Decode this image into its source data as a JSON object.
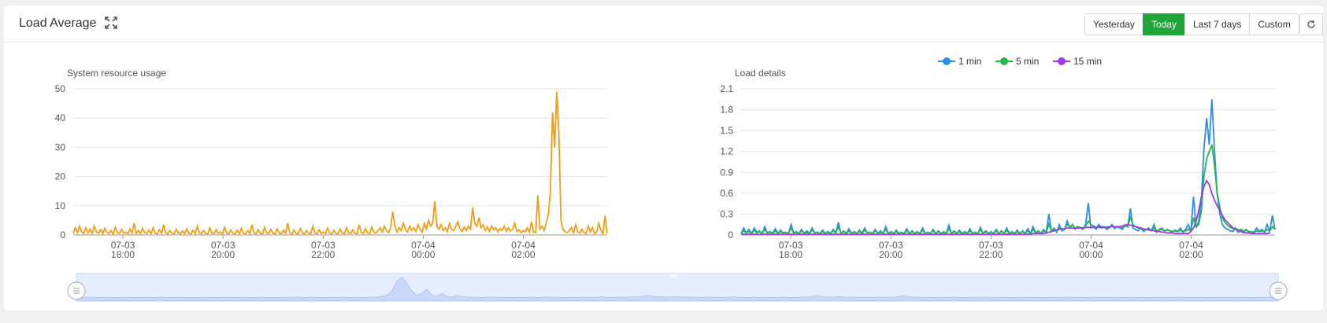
{
  "header": {
    "title": "Load Average",
    "expand_icon": "expand-icon",
    "ranges": [
      "Yesterday",
      "Today",
      "Last 7 days",
      "Custom"
    ],
    "active_range": "Today",
    "refresh_icon": "refresh-icon"
  },
  "colors": {
    "accent": "#20a53a",
    "resource": "#f39c12",
    "min1": "#2d8cf0",
    "min5": "#20b845",
    "min15": "#9f3af0"
  },
  "chart_data": [
    {
      "type": "area",
      "title": "System resource usage",
      "ylim": [
        0,
        50
      ],
      "yticks": [
        0,
        10,
        20,
        30,
        40,
        50
      ],
      "xticks": [
        [
          "07-03",
          "18:00"
        ],
        [
          "07-03",
          "20:00"
        ],
        [
          "07-03",
          "22:00"
        ],
        [
          "07-04",
          "00:00"
        ],
        [
          "07-04",
          "02:00"
        ]
      ],
      "series": [
        {
          "values": [
            0.5,
            2.5,
            0.8,
            3,
            1,
            0.5,
            2.5,
            0.7,
            2,
            0.5,
            3,
            1,
            0.6,
            1.8,
            0.4,
            2.2,
            0.9,
            0.5,
            1.5,
            0.3,
            2.6,
            0.8,
            0.5,
            1.9,
            0.6,
            1,
            0.4,
            2,
            0.7,
            4,
            0.5,
            1.5,
            0.4,
            2.2,
            0.8,
            0.5,
            1.6,
            0.4,
            2.5,
            0.6,
            0.4,
            1.8,
            0.5,
            3.5,
            0.8,
            0.4,
            1.5,
            0.6,
            0.4,
            2,
            0.7,
            0.4,
            1.4,
            0.4,
            2.1,
            0.6,
            0.4,
            1.6,
            0.5,
            3,
            0.7,
            0.4,
            1.5,
            0.5,
            0.4,
            2.4,
            0.6,
            0.4,
            1.8,
            0.5,
            1,
            0.4,
            2.6,
            0.6,
            0.4,
            1.7,
            0.5,
            0.4,
            1.6,
            0.4,
            2.3,
            0.6,
            0.4,
            1.5,
            0.5,
            3.5,
            0.7,
            0.4,
            1.8,
            0.5,
            0.4,
            2.6,
            0.7,
            0.5,
            1.9,
            0.6,
            0.4,
            2.1,
            0.6,
            0.4,
            1.6,
            0.5,
            4,
            0.7,
            0.4,
            1.7,
            0.5,
            0.4,
            2.2,
            0.6,
            0.4,
            1.5,
            0.5,
            0.4,
            3,
            0.6,
            0.4,
            1.8,
            0.5,
            1,
            0.4,
            2.4,
            0.6,
            0.4,
            1.6,
            0.5,
            0.4,
            2,
            0.6,
            0.4,
            2.6,
            0.7,
            0.5,
            1.8,
            0.6,
            0.4,
            3.5,
            0.8,
            0.5,
            2.2,
            0.7,
            0.5,
            2.8,
            0.9,
            0.6,
            1.5,
            2.5,
            1,
            3,
            1.5,
            0.8,
            2.5,
            8,
            3,
            1,
            2.5,
            1.5,
            4,
            2,
            1,
            3,
            1.5,
            2.5,
            1.2,
            3.5,
            2,
            1,
            4,
            2,
            5,
            3,
            4,
            11.5,
            3,
            2,
            3.5,
            1.5,
            2.5,
            1.2,
            4,
            2,
            1.5,
            3,
            4.5,
            2,
            1.2,
            2.8,
            1.5,
            3,
            2,
            9.5,
            4,
            3,
            6,
            2.5,
            3.5,
            1.5,
            2.8,
            1.2,
            3,
            1.8,
            2.5,
            1,
            2.2,
            1.5,
            3,
            1.2,
            2.5,
            1.4,
            2,
            4,
            1.2,
            1.8,
            0.8,
            1.5,
            1,
            2.5,
            1,
            4.5,
            1,
            0.8,
            13.5,
            2,
            3,
            1.5,
            4,
            7,
            15,
            42,
            30,
            49,
            35,
            5,
            2,
            1,
            0.8,
            1.5,
            2.5,
            0.8,
            3.5,
            1,
            0.6,
            2,
            0.8,
            0.5,
            3,
            1,
            2.5,
            0.5,
            1,
            4,
            1.5,
            0.5,
            6.5,
            0.5
          ]
        }
      ],
      "slider_preview": [
        1,
        1.2,
        1,
        1.1,
        1,
        1,
        1.1,
        1,
        1,
        1,
        1.1,
        1,
        1,
        1,
        1.1,
        1,
        1,
        1.2,
        1,
        1,
        1.1,
        1,
        1,
        1,
        1,
        1,
        1.1,
        1,
        1,
        1,
        1.1,
        1,
        1,
        1.1,
        1,
        1,
        1,
        1.1,
        1,
        1,
        1,
        1.1,
        1,
        1,
        1.2,
        1,
        1,
        1.1,
        1,
        1,
        1,
        1.1,
        1,
        1.2,
        1,
        1,
        1.1,
        1,
        1,
        1.2,
        1,
        1.5,
        2,
        4,
        9,
        11,
        8,
        4,
        2,
        3,
        5,
        2,
        1.5,
        3,
        1.5,
        1,
        2,
        1.5,
        1,
        1.2,
        1,
        1,
        1,
        1.2,
        1,
        1.1,
        1,
        1,
        1,
        1.1,
        1,
        1.2,
        1,
        1,
        1.3,
        1,
        1.1,
        1,
        1,
        1.1,
        1,
        1.2,
        1,
        1.1,
        1,
        1.3,
        1,
        1.1,
        1,
        1.2,
        1,
        1.3,
        1.2,
        1.5,
        2,
        1.6,
        1.4,
        1.3,
        1.1,
        1.5,
        1.3,
        1.2,
        1.1,
        1.2,
        1.1,
        1,
        1.2,
        1.1,
        1,
        1.1,
        1,
        1.3,
        1.1,
        1,
        1,
        1.1,
        1,
        1,
        1.1,
        1,
        1,
        1.2,
        1,
        1,
        1,
        1.2,
        1.1,
        1.4,
        2,
        1.3,
        1.2,
        1.1,
        1.4,
        1.2,
        1,
        1.2,
        1.1,
        1,
        1.1,
        1,
        1.2,
        1.1,
        1,
        1.1,
        1.3,
        1.8,
        1.4,
        1.2,
        1.1,
        1,
        1.1,
        1,
        1,
        1.1,
        1,
        1.2,
        1,
        1,
        1,
        1.1,
        1,
        1.2,
        1.1,
        1,
        1,
        1.1,
        1,
        1,
        1,
        1.1,
        1,
        1.1,
        1,
        1,
        1,
        1.1,
        1,
        1,
        1.2,
        1,
        1.1,
        1,
        1,
        1.1,
        1,
        1.1,
        1,
        1.1,
        1,
        1,
        1.1,
        1,
        1,
        1.1,
        1,
        1,
        1.1,
        1,
        1,
        1.1,
        1,
        1.2,
        1,
        1,
        1.1,
        1,
        1,
        1,
        1.1,
        1,
        1.1,
        1,
        1,
        1.1,
        1,
        1,
        1.1,
        1,
        1,
        1.1,
        1
      ]
    },
    {
      "type": "line",
      "title": "Load details",
      "ylim": [
        0,
        2.1
      ],
      "yticks": [
        0,
        0.3,
        0.6,
        0.9,
        1.2,
        1.5,
        1.8,
        2.1
      ],
      "xticks": [
        [
          "07-03",
          "18:00"
        ],
        [
          "07-03",
          "20:00"
        ],
        [
          "07-03",
          "22:00"
        ],
        [
          "07-04",
          "00:00"
        ],
        [
          "07-04",
          "02:00"
        ]
      ],
      "legend": [
        "1 min",
        "5 min",
        "15 min"
      ],
      "series": [
        {
          "name": "1 min",
          "values": [
            0.02,
            0.1,
            0.03,
            0.08,
            0.02,
            0.1,
            0.04,
            0.06,
            0.02,
            0.12,
            0.03,
            0.05,
            0.02,
            0.09,
            0.02,
            0.07,
            0.03,
            0.04,
            0.02,
            0.15,
            0.03,
            0.05,
            0.02,
            0.08,
            0.02,
            0.06,
            0.02,
            0.1,
            0.03,
            0.04,
            0.02,
            0.07,
            0.02,
            0.05,
            0.02,
            0.08,
            0.03,
            0.18,
            0.02,
            0.06,
            0.02,
            0.09,
            0.02,
            0.05,
            0.02,
            0.07,
            0.02,
            0.1,
            0.03,
            0.04,
            0.02,
            0.08,
            0.02,
            0.06,
            0.02,
            0.12,
            0.02,
            0.05,
            0.02,
            0.07,
            0.02,
            0.04,
            0.02,
            0.09,
            0.02,
            0.06,
            0.02,
            0.05,
            0.02,
            0.1,
            0.02,
            0.04,
            0.02,
            0.08,
            0.02,
            0.06,
            0.02,
            0.05,
            0.02,
            0.14,
            0.02,
            0.06,
            0.02,
            0.07,
            0.02,
            0.05,
            0.02,
            0.09,
            0.02,
            0.04,
            0.02,
            0.11,
            0.02,
            0.06,
            0.02,
            0.05,
            0.02,
            0.08,
            0.02,
            0.06,
            0.02,
            0.1,
            0.02,
            0.05,
            0.02,
            0.07,
            0.02,
            0.06,
            0.02,
            0.09,
            0.02,
            0.12,
            0.03,
            0.06,
            0.02,
            0.08,
            0.03,
            0.3,
            0.05,
            0.1,
            0.04,
            0.15,
            0.06,
            0.08,
            0.2,
            0.1,
            0.15,
            0.08,
            0.12,
            0.1,
            0.08,
            0.15,
            0.46,
            0.1,
            0.12,
            0.08,
            0.15,
            0.1,
            0.12,
            0.08,
            0.1,
            0.15,
            0.09,
            0.12,
            0.1,
            0.08,
            0.15,
            0.12,
            0.38,
            0.1,
            0.08,
            0.06,
            0.1,
            0.05,
            0.08,
            0.1,
            0.06,
            0.15,
            0.04,
            0.08,
            0.1,
            0.05,
            0.08,
            0.06,
            0.04,
            0.07,
            0.05,
            0.1,
            0.04,
            0.08,
            0.15,
            0.05,
            0.55,
            0.1,
            0.2,
            0.5,
            1.25,
            1.68,
            1.3,
            1.95,
            1.2,
            0.6,
            0.3,
            0.15,
            0.1,
            0.08,
            0.06,
            0.05,
            0.1,
            0.04,
            0.06,
            0.03,
            0.08,
            0.04,
            0.05,
            0.03,
            0.1,
            0.05,
            0.08,
            0.04,
            0.15,
            0.05,
            0.28,
            0.08
          ]
        },
        {
          "name": "5 min",
          "values": [
            0.02,
            0.06,
            0.03,
            0.05,
            0.02,
            0.07,
            0.03,
            0.05,
            0.02,
            0.08,
            0.03,
            0.04,
            0.02,
            0.06,
            0.02,
            0.05,
            0.03,
            0.04,
            0.02,
            0.1,
            0.03,
            0.04,
            0.02,
            0.06,
            0.02,
            0.04,
            0.02,
            0.07,
            0.03,
            0.04,
            0.02,
            0.05,
            0.02,
            0.04,
            0.02,
            0.06,
            0.03,
            0.12,
            0.02,
            0.05,
            0.02,
            0.06,
            0.02,
            0.04,
            0.02,
            0.05,
            0.02,
            0.07,
            0.03,
            0.04,
            0.02,
            0.06,
            0.02,
            0.04,
            0.02,
            0.08,
            0.02,
            0.04,
            0.02,
            0.05,
            0.02,
            0.04,
            0.02,
            0.06,
            0.02,
            0.05,
            0.02,
            0.04,
            0.02,
            0.07,
            0.02,
            0.04,
            0.02,
            0.06,
            0.02,
            0.05,
            0.02,
            0.04,
            0.02,
            0.09,
            0.02,
            0.05,
            0.02,
            0.05,
            0.02,
            0.04,
            0.02,
            0.06,
            0.02,
            0.04,
            0.02,
            0.08,
            0.02,
            0.05,
            0.02,
            0.04,
            0.02,
            0.06,
            0.02,
            0.05,
            0.02,
            0.07,
            0.02,
            0.04,
            0.02,
            0.05,
            0.02,
            0.05,
            0.02,
            0.06,
            0.02,
            0.08,
            0.03,
            0.05,
            0.02,
            0.06,
            0.03,
            0.16,
            0.05,
            0.08,
            0.05,
            0.1,
            0.08,
            0.09,
            0.15,
            0.12,
            0.14,
            0.1,
            0.12,
            0.11,
            0.1,
            0.13,
            0.2,
            0.15,
            0.13,
            0.11,
            0.13,
            0.12,
            0.12,
            0.1,
            0.11,
            0.13,
            0.11,
            0.12,
            0.11,
            0.1,
            0.13,
            0.12,
            0.25,
            0.15,
            0.12,
            0.1,
            0.1,
            0.08,
            0.08,
            0.09,
            0.07,
            0.1,
            0.06,
            0.07,
            0.08,
            0.06,
            0.07,
            0.06,
            0.05,
            0.06,
            0.05,
            0.07,
            0.05,
            0.06,
            0.08,
            0.06,
            0.25,
            0.12,
            0.15,
            0.35,
            0.85,
            1.1,
            1.2,
            1.3,
            1.0,
            0.6,
            0.4,
            0.25,
            0.18,
            0.14,
            0.11,
            0.09,
            0.1,
            0.07,
            0.08,
            0.06,
            0.07,
            0.05,
            0.05,
            0.04,
            0.06,
            0.05,
            0.06,
            0.05,
            0.08,
            0.06,
            0.12,
            0.08
          ]
        },
        {
          "name": "15 min",
          "values": [
            0.01,
            0.01,
            0.01,
            0.01,
            0.01,
            0.01,
            0.01,
            0.01,
            0.01,
            0.01,
            0.01,
            0.01,
            0.01,
            0.01,
            0.01,
            0.01,
            0.01,
            0.01,
            0.01,
            0.01,
            0.01,
            0.01,
            0.01,
            0.01,
            0.01,
            0.01,
            0.01,
            0.01,
            0.01,
            0.01,
            0.01,
            0.01,
            0.01,
            0.01,
            0.01,
            0.01,
            0.01,
            0.01,
            0.01,
            0.01,
            0.01,
            0.01,
            0.01,
            0.01,
            0.01,
            0.01,
            0.01,
            0.01,
            0.01,
            0.01,
            0.01,
            0.01,
            0.01,
            0.01,
            0.01,
            0.01,
            0.01,
            0.01,
            0.01,
            0.01,
            0.01,
            0.01,
            0.01,
            0.01,
            0.01,
            0.01,
            0.01,
            0.01,
            0.01,
            0.01,
            0.01,
            0.01,
            0.01,
            0.01,
            0.01,
            0.01,
            0.01,
            0.01,
            0.01,
            0.01,
            0.01,
            0.01,
            0.01,
            0.01,
            0.01,
            0.01,
            0.01,
            0.01,
            0.01,
            0.01,
            0.01,
            0.01,
            0.01,
            0.01,
            0.01,
            0.01,
            0.01,
            0.01,
            0.01,
            0.01,
            0.01,
            0.01,
            0.01,
            0.01,
            0.01,
            0.01,
            0.01,
            0.01,
            0.01,
            0.01,
            0.01,
            0.02,
            0.02,
            0.02,
            0.02,
            0.02,
            0.03,
            0.04,
            0.05,
            0.06,
            0.07,
            0.08,
            0.09,
            0.09,
            0.1,
            0.1,
            0.1,
            0.1,
            0.1,
            0.1,
            0.1,
            0.11,
            0.11,
            0.11,
            0.11,
            0.11,
            0.11,
            0.11,
            0.11,
            0.11,
            0.12,
            0.12,
            0.12,
            0.12,
            0.12,
            0.13,
            0.14,
            0.15,
            0.14,
            0.13,
            0.12,
            0.11,
            0.1,
            0.09,
            0.08,
            0.07,
            0.07,
            0.06,
            0.05,
            0.05,
            0.04,
            0.04,
            0.03,
            0.03,
            0.03,
            0.02,
            0.02,
            0.02,
            0.02,
            0.02,
            0.02,
            0.05,
            0.1,
            0.2,
            0.35,
            0.55,
            0.7,
            0.78,
            0.72,
            0.6,
            0.5,
            0.42,
            0.35,
            0.28,
            0.22,
            0.18,
            0.14,
            0.1,
            0.08,
            0.06,
            0.05,
            0.04,
            0.03,
            0.03,
            0.02,
            0.02,
            0.02,
            0.02,
            0.02,
            0.02,
            0.02,
            0.03
          ]
        }
      ]
    }
  ]
}
